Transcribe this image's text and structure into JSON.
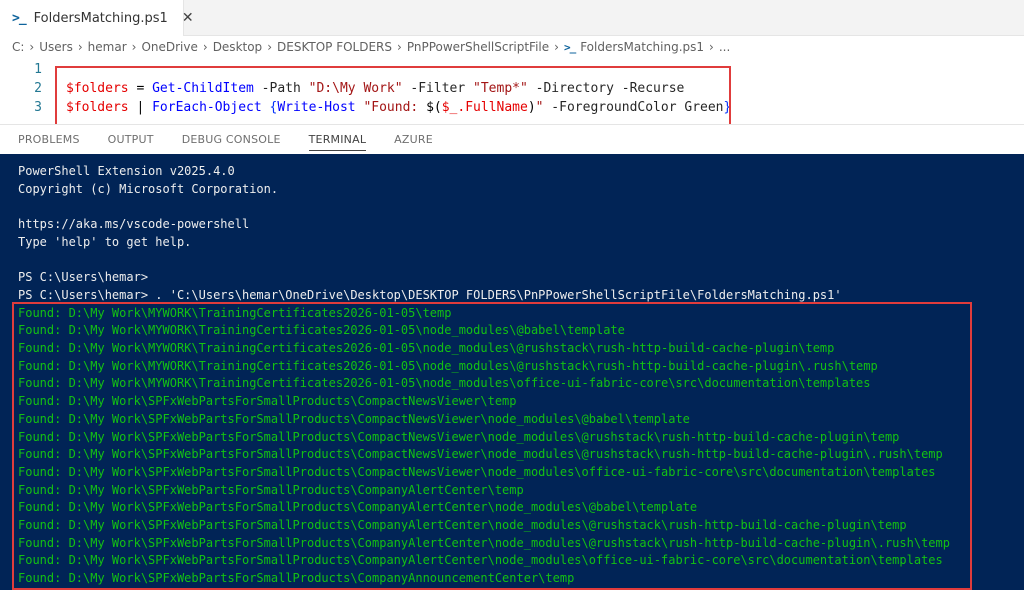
{
  "tab": {
    "icon": "powershell-icon",
    "label": "FoldersMatching.ps1",
    "close": "✕"
  },
  "breadcrumb": {
    "items": [
      "C:",
      "Users",
      "hemar",
      "OneDrive",
      "Desktop",
      "DESKTOP FOLDERS",
      "PnPPowerShellScriptFile",
      "FoldersMatching.ps1",
      "..."
    ],
    "separator": "›"
  },
  "editor": {
    "line_numbers": [
      "1",
      "2",
      "3"
    ],
    "line2": {
      "var": "$folders",
      "eq": " = ",
      "cmd": "Get-ChildItem",
      "p1": " -Path ",
      "s1": "\"D:\\My Work\"",
      "p2": " -Filter ",
      "s2": "\"Temp*\"",
      "p3": " -Directory -Recurse"
    },
    "line3": {
      "var": "$folders",
      "pipe": " | ",
      "cmd": "ForEach-Object",
      "sp": " ",
      "ob": "{",
      "cmd2": "Write-Host",
      "s_open": " \"Found: ",
      "sub_open": "$(",
      "sub_var": "$_.FullName",
      "sub_close": ")",
      "s_close": "\"",
      "p": " -ForegroundColor Green",
      "cb": "}"
    }
  },
  "panel": {
    "tabs": [
      "PROBLEMS",
      "OUTPUT",
      "DEBUG CONSOLE",
      "TERMINAL",
      "AZURE"
    ],
    "active_tab": "TERMINAL"
  },
  "terminal": {
    "header": [
      "PowerShell Extension v2025.4.0",
      "Copyright (c) Microsoft Corporation.",
      "",
      "https://aka.ms/vscode-powershell",
      "Type 'help' to get help.",
      "",
      "PS C:\\Users\\hemar>",
      "PS C:\\Users\\hemar> . 'C:\\Users\\hemar\\OneDrive\\Desktop\\DESKTOP FOLDERS\\PnPPowerShellScriptFile\\FoldersMatching.ps1'"
    ],
    "found": [
      "Found: D:\\My Work\\MYWORK\\TrainingCertificates2026-01-05\\temp",
      "Found: D:\\My Work\\MYWORK\\TrainingCertificates2026-01-05\\node_modules\\@babel\\template",
      "Found: D:\\My Work\\MYWORK\\TrainingCertificates2026-01-05\\node_modules\\@rushstack\\rush-http-build-cache-plugin\\temp",
      "Found: D:\\My Work\\MYWORK\\TrainingCertificates2026-01-05\\node_modules\\@rushstack\\rush-http-build-cache-plugin\\.rush\\temp",
      "Found: D:\\My Work\\MYWORK\\TrainingCertificates2026-01-05\\node_modules\\office-ui-fabric-core\\src\\documentation\\templates",
      "Found: D:\\My Work\\SPFxWebPartsForSmallProducts\\CompactNewsViewer\\temp",
      "Found: D:\\My Work\\SPFxWebPartsForSmallProducts\\CompactNewsViewer\\node_modules\\@babel\\template",
      "Found: D:\\My Work\\SPFxWebPartsForSmallProducts\\CompactNewsViewer\\node_modules\\@rushstack\\rush-http-build-cache-plugin\\temp",
      "Found: D:\\My Work\\SPFxWebPartsForSmallProducts\\CompactNewsViewer\\node_modules\\@rushstack\\rush-http-build-cache-plugin\\.rush\\temp",
      "Found: D:\\My Work\\SPFxWebPartsForSmallProducts\\CompactNewsViewer\\node_modules\\office-ui-fabric-core\\src\\documentation\\templates",
      "Found: D:\\My Work\\SPFxWebPartsForSmallProducts\\CompanyAlertCenter\\temp",
      "Found: D:\\My Work\\SPFxWebPartsForSmallProducts\\CompanyAlertCenter\\node_modules\\@babel\\template",
      "Found: D:\\My Work\\SPFxWebPartsForSmallProducts\\CompanyAlertCenter\\node_modules\\@rushstack\\rush-http-build-cache-plugin\\temp",
      "Found: D:\\My Work\\SPFxWebPartsForSmallProducts\\CompanyAlertCenter\\node_modules\\@rushstack\\rush-http-build-cache-plugin\\.rush\\temp",
      "Found: D:\\My Work\\SPFxWebPartsForSmallProducts\\CompanyAlertCenter\\node_modules\\office-ui-fabric-core\\src\\documentation\\templates",
      "Found: D:\\My Work\\SPFxWebPartsForSmallProducts\\CompanyAnnouncementCenter\\temp"
    ]
  },
  "colors": {
    "terminal_bg": "#012456",
    "found_text": "#13c113",
    "highlight_box": "#e03c3c",
    "ps_icon": "#0e639c"
  }
}
